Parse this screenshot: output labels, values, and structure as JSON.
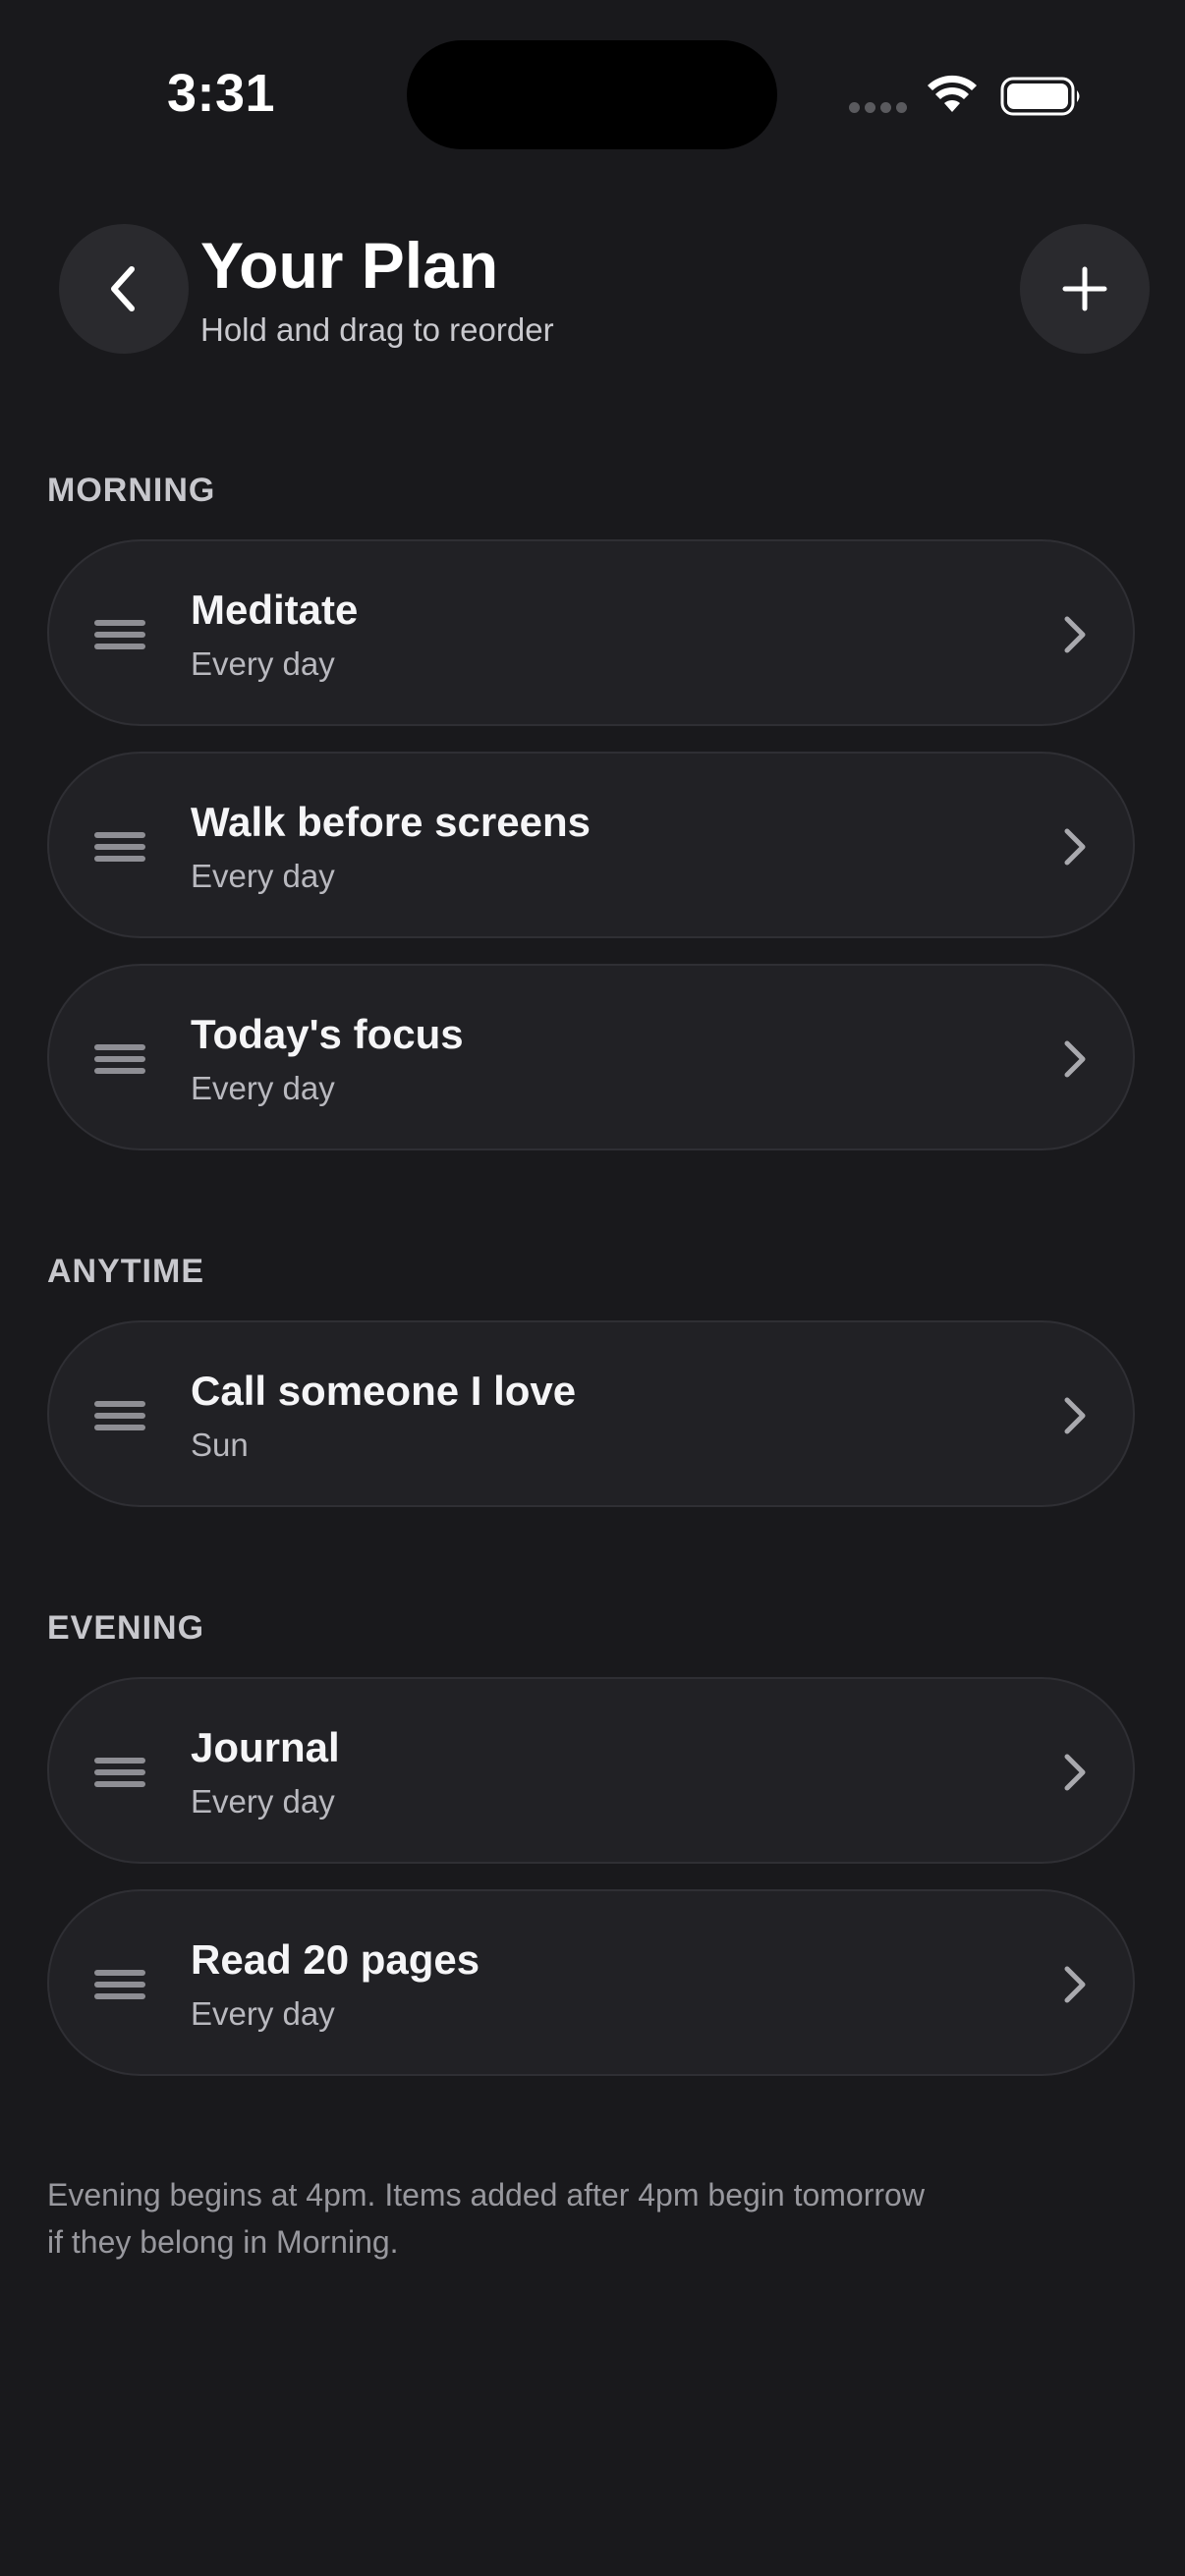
{
  "status_bar": {
    "time": "3:31"
  },
  "header": {
    "title": "Your Plan",
    "subtitle": "Hold and drag to reorder",
    "back_icon": "chevron-left-icon",
    "add_icon": "plus-icon"
  },
  "sections": [
    {
      "label": "MORNING",
      "items": [
        {
          "title": "Meditate",
          "schedule": "Every day"
        },
        {
          "title": "Walk before screens",
          "schedule": "Every day"
        },
        {
          "title": "Today's focus",
          "schedule": "Every day"
        }
      ]
    },
    {
      "label": "ANYTIME",
      "items": [
        {
          "title": "Call someone I love",
          "schedule": "Sun"
        }
      ]
    },
    {
      "label": "EVENING",
      "items": [
        {
          "title": "Journal",
          "schedule": "Every day"
        },
        {
          "title": "Read 20 pages",
          "schedule": "Every day"
        }
      ]
    }
  ],
  "footnote": "Evening begins at 4pm. Items added after 4pm begin tomorrow if they belong in Morning.",
  "colors": {
    "background": "#19191c",
    "card": "#212125",
    "button": "#2a2a2e"
  }
}
